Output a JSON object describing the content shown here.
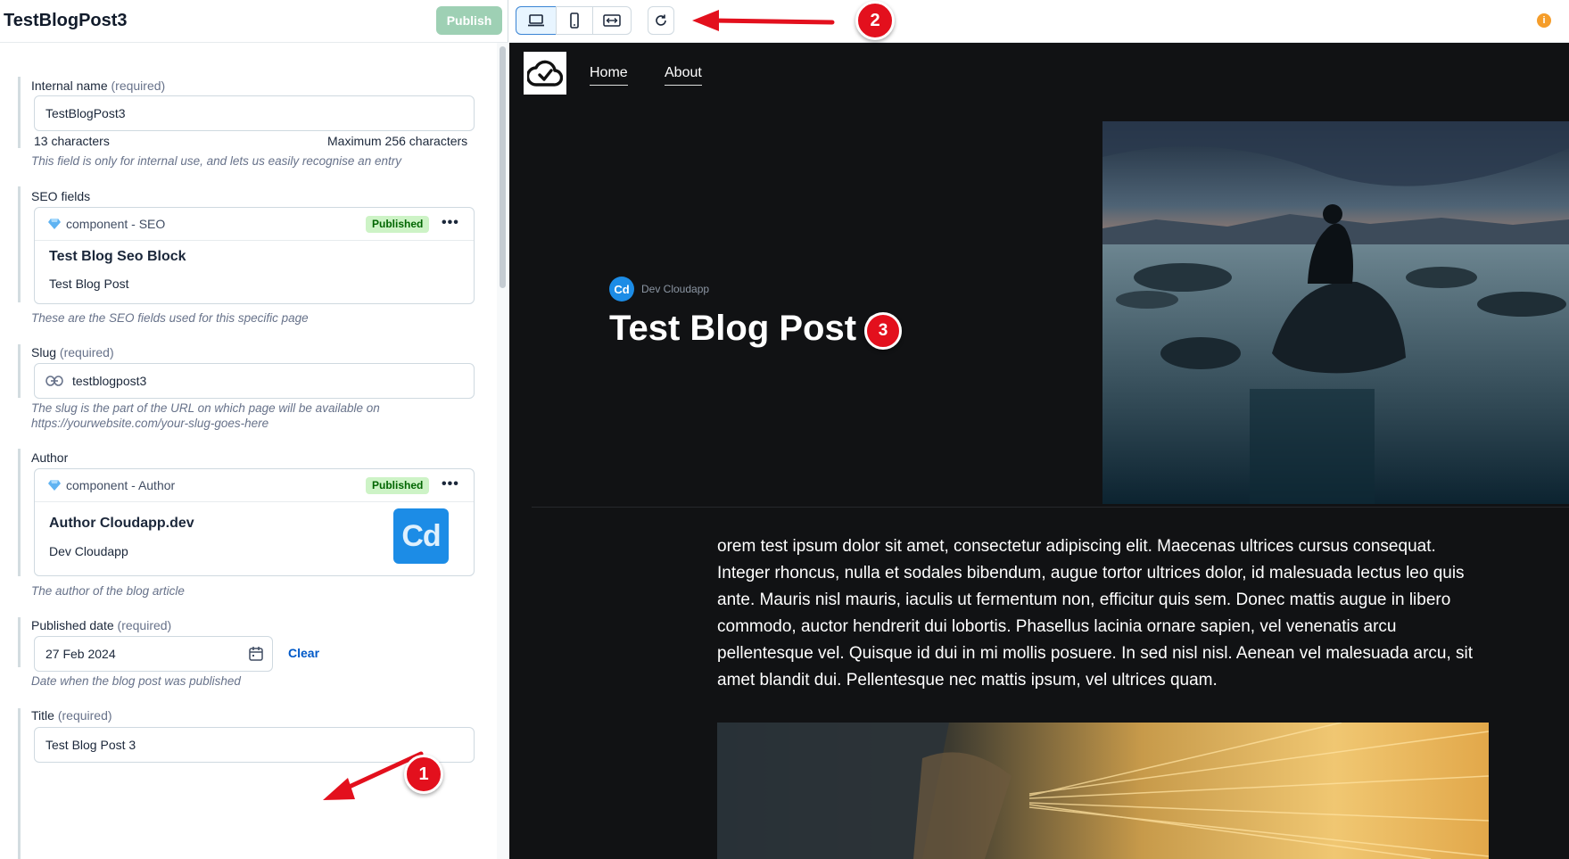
{
  "editor": {
    "entry_title": "TestBlogPost3",
    "publish_label": "Publish",
    "internal_name": {
      "label": "Internal name",
      "required": "(required)",
      "value": "TestBlogPost3",
      "count": "13 characters",
      "max": "Maximum 256 characters",
      "help": "This field is only for internal use, and lets us easily recognise an entry"
    },
    "seo": {
      "label": "SEO fields",
      "card_type": "component - SEO",
      "status": "Published",
      "menu": "•••",
      "title": "Test Blog Seo Block",
      "subtitle": "Test Blog Post",
      "help": "These are the SEO fields used for this specific page"
    },
    "slug": {
      "label": "Slug",
      "required": "(required)",
      "value": "testblogpost3",
      "help_line1": "The slug is the part of the URL on which page will be available on",
      "help_line2": "https://yourwebsite.com/your-slug-goes-here"
    },
    "author": {
      "label": "Author",
      "card_type": "component - Author",
      "status": "Published",
      "menu": "•••",
      "title": "Author Cloudapp.dev",
      "subtitle": "Dev Cloudapp",
      "thumb_text": "Cd",
      "help": "The author of the blog article"
    },
    "published_date": {
      "label": "Published date",
      "required": "(required)",
      "value": "27 Feb 2024",
      "clear_label": "Clear",
      "help": "Date when the blog post was published"
    },
    "title_field": {
      "label": "Title",
      "required": "(required)",
      "value": "Test Blog Post 3"
    }
  },
  "toolbar": {
    "icons": [
      "laptop-icon",
      "mobile-icon",
      "resize-icon",
      "refresh-icon"
    ],
    "info_badge": "i"
  },
  "preview": {
    "nav": [
      "Home",
      "About"
    ],
    "author_avatar": "Cd",
    "author_name": "Dev Cloudapp",
    "post_title": "Test Blog Post 3",
    "body": "orem test ipsum dolor sit amet, consectetur adipiscing elit. Maecenas ultrices cursus consequat. Integer rhoncus, nulla et sodales bibendum, augue tortor ultrices dolor, id malesuada lectus leo quis ante. Mauris nisl mauris, iaculis ut fermentum non, efficitur quis sem. Donec mattis augue in libero commodo, auctor hendrerit dui lobortis. Phasellus lacinia ornare sapien, vel venenatis arcu pellentesque vel. Quisque id dui in mi mollis posuere. In sed nisl nisl. Aenean vel malesuada arcu, sit amet blandit dui. Pellentesque nec mattis ipsum, vel ultrices quam."
  },
  "annotations": {
    "step1": "1",
    "step2": "2",
    "step3": "3",
    "color": "#e3101d"
  },
  "colors": {
    "publish": "#9ed0b4",
    "badge_bg": "#cdf3c6",
    "badge_text": "#006500",
    "link": "#0059c8",
    "preview_bg": "#111214",
    "active_toggle": "#e8f5ff"
  }
}
